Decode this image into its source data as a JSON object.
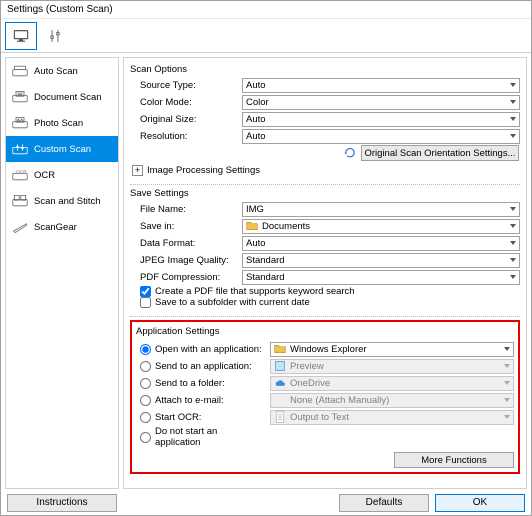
{
  "window": {
    "title": "Settings (Custom Scan)"
  },
  "sidebar": {
    "items": [
      {
        "label": "Auto Scan"
      },
      {
        "label": "Document Scan"
      },
      {
        "label": "Photo Scan"
      },
      {
        "label": "Custom Scan"
      },
      {
        "label": "OCR"
      },
      {
        "label": "Scan and Stitch"
      },
      {
        "label": "ScanGear"
      }
    ]
  },
  "scan_options": {
    "title": "Scan Options",
    "source_type_label": "Source Type:",
    "source_type_value": "Auto",
    "color_mode_label": "Color Mode:",
    "color_mode_value": "Color",
    "original_size_label": "Original Size:",
    "original_size_value": "Auto",
    "resolution_label": "Resolution:",
    "resolution_value": "Auto",
    "orientation_btn": "Original Scan Orientation Settings...",
    "img_proc_label": "Image Processing Settings"
  },
  "save_settings": {
    "title": "Save Settings",
    "file_name_label": "File Name:",
    "file_name_value": "IMG",
    "save_in_label": "Save in:",
    "save_in_value": "Documents",
    "data_format_label": "Data Format:",
    "data_format_value": "Auto",
    "jpeg_quality_label": "JPEG Image Quality:",
    "jpeg_quality_value": "Standard",
    "pdf_comp_label": "PDF Compression:",
    "pdf_comp_value": "Standard",
    "chk_pdf_keyword": "Create a PDF file that supports keyword search",
    "chk_subfolder": "Save to a subfolder with current date"
  },
  "app_settings": {
    "title": "Application Settings",
    "open_app_label": "Open with an application:",
    "open_app_value": "Windows Explorer",
    "send_app_label": "Send to an application:",
    "send_app_value": "Preview",
    "send_folder_label": "Send to a folder:",
    "send_folder_value": "OneDrive",
    "attach_email_label": "Attach to e-mail:",
    "attach_email_value": "None (Attach Manually)",
    "start_ocr_label": "Start OCR:",
    "start_ocr_value": "Output to Text",
    "do_not_start_label": "Do not start an application",
    "more_functions": "More Functions"
  },
  "footer": {
    "instructions": "Instructions",
    "defaults": "Defaults",
    "ok": "OK"
  }
}
